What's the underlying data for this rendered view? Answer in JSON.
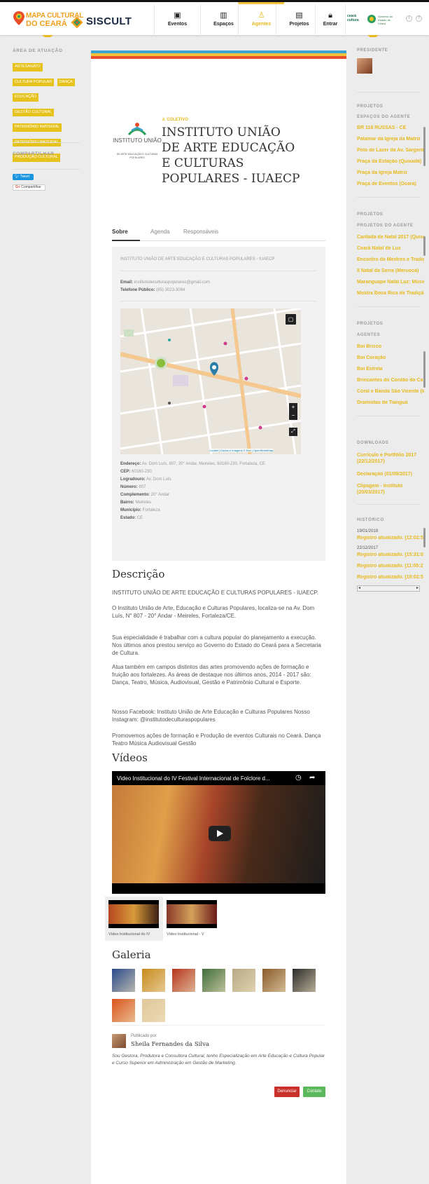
{
  "header": {
    "logo_line1": "MAPA CULTURAL",
    "logo_line2": "DO CEARÁ",
    "siscult": "SISCULT",
    "nav": [
      {
        "label": "Eventos",
        "icon": "calendar-icon"
      },
      {
        "label": "Espaços",
        "icon": "building-icon"
      },
      {
        "label": "Agentes",
        "icon": "person-icon",
        "active": true
      },
      {
        "label": "Projetos",
        "icon": "document-icon"
      },
      {
        "label": "Entrar",
        "icon": "lock-icon"
      }
    ],
    "right_logo": "ceará cultura",
    "gov_text": "Governo do Estado do Ceará"
  },
  "left": {
    "area_title": "ÁREA DE ATUAÇÃO",
    "tags": [
      "ARTESANATO",
      "CULTURA POPULAR",
      "DANÇA",
      "EDUCAÇÃO",
      "GESTÃO CULTURAL",
      "PATRIMÔNIO IMATERIAL",
      "PATRIMÔNIO MATERIAL",
      "PRODUÇÃO CULTURAL"
    ],
    "share_title": "COMPARTILHAR",
    "tweet": "Tweet",
    "gplus": "Compartilhar"
  },
  "profile": {
    "type": "COLETIVO",
    "name": "INSTITUTO UNIÃO DE ARTE EDUCAÇÃO E CULTURAS POPULARES - IUAECP",
    "logo_text": "INSTITUTO UNIÃO",
    "logo_sub": "DE ARTE EDUCAÇÃO E CULTURAS POPULARES",
    "tabs": [
      "Sobre",
      "Agenda",
      "Responsáveis"
    ],
    "short_desc": "INSTITUTO UNIÃO DE ARTE EDUCAÇÃO E CULTURAS POPULARES - IUAECP",
    "email_label": "Email:",
    "email": "institutodeculturaspopulares@gmail.com",
    "phone_label": "Telefone Público:",
    "phone": "(85) 3023-3064",
    "map_attr": "Leaflet | Dados e Imagens © Esri | OpenStreetMap",
    "address": [
      {
        "label": "Endereço:",
        "value": "Av. Dom Luís, 807, 20° Andar, Meireles, 60160-230, Fortaleza, CE"
      },
      {
        "label": "CEP:",
        "value": "60160-230"
      },
      {
        "label": "Logradouro:",
        "value": "Av. Dom Luís"
      },
      {
        "label": "Número:",
        "value": "807"
      },
      {
        "label": "Complemento:",
        "value": "20° Andar"
      },
      {
        "label": "Bairro:",
        "value": "Meireles"
      },
      {
        "label": "Município:",
        "value": "Fortaleza"
      },
      {
        "label": "Estado:",
        "value": "CE"
      }
    ]
  },
  "description": {
    "title": "Descrição",
    "paragraphs": [
      "INSTITUTO UNIÃO DE ARTE EDUCAÇÃO E CULTURAS POPULARES - IUAECP.",
      "O Instituto União de Arte, Educação e Culturas Populares, localiza-se na Av. Dom Luís, N° 807 - 20° Andar - Meireles, Fortaleza/CE.",
      "Sua especialidade é trabalhar com a cultura popular do planejamento a execução. Nos últimos anos prestou serviço ao Governo do Estado do Ceará para a Secretaria de Cultura.",
      "Atua também em campos distintos das artes promovendo ações de formação e fruição aos fortalezes. As áreas de destaque nos últimos anos, 2014 - 2017 são: Dança, Teatro, Música, Audiovisual, Gestão e Patrimônio Cultural e Esporte.",
      "Nosso Facebook: Instituto União de Arte Educação e Culturas Populares Nosso Instagram: @institutodeculturaspopulares",
      "Promovemos ações de formação e Produção de eventos Culturais no Ceará. Dança  Teatro  Música  Audiovisual  Gestão"
    ]
  },
  "videos": {
    "title": "Vídeos",
    "player_title": "Video Institucional do IV Festival Internacional de Folclore d...",
    "thumbs": [
      "Vídeo Institucional do IV",
      "Vídeo Institucional - V"
    ]
  },
  "gallery": {
    "title": "Galeria",
    "colors": [
      "#2a4a8a",
      "#c88a1c",
      "#b5361f",
      "#3f6d3a",
      "#b8a985",
      "#8a5a2a",
      "#2a2a2a",
      "#d9541a",
      "#e0c79a"
    ]
  },
  "author": {
    "published_by": "Publicado por",
    "name": "Sheila Fernandes da Silva",
    "bio": "Sou Gestora, Produtora e Consultora Cultural, tenho Especialização em Arte Educação e Cultura Popular e Curso Superior em Administração em Gestão de Marketing."
  },
  "actions": {
    "report": "Denunciar",
    "contact": "Contato"
  },
  "right": {
    "president_title": "PRESIDENTE",
    "projects_title": "PROJETOS",
    "spaces_title": "ESPAÇOS DO AGENTE",
    "spaces": [
      "BR 116 RUSSAS - CE",
      "Patamar da Igreja da Matriz",
      "Polo de Lazer da Av. Sargento",
      "Praça da Estação (Quixadá)",
      "Praça da Igreja Matriz",
      "Praça de Eventos (Ocara)"
    ],
    "projects2_title": "PROJETOS",
    "agent_projects_title": "PROJETOS DO AGENTE",
    "agent_projects": [
      "Cantada de Natal 2017 (Quixadá)",
      "Ceará Natal de Luz",
      "Encontro de Mestres e Tradições",
      "II Natal da Serra (Meruoca)",
      "Maranguape Natal Luz: Música",
      "Mostra Boca Rica de Tradição"
    ],
    "projects3_title": "PROJETOS",
    "agents_title": "AGENTES",
    "agents": [
      "Boi Bricco",
      "Boi Coração",
      "Boi Estrela",
      "Brincantes do Cordão do Caroá",
      "Coral e Banda São Vicente (Icó)",
      "Dramistas de Tianguá"
    ],
    "downloads_title": "DOWNLOADS",
    "downloads": [
      "Currículo e Portfólio 2017 (22/12/2017)",
      "Declaração (01/09/2017)",
      "Clipagem - Instituto (20/03/2017)"
    ],
    "history_title": "HISTÓRICO",
    "history": [
      {
        "date": "19/01/2018",
        "entry": "Registro atualizado. [12:02:5"
      },
      {
        "date": "22/12/2017",
        "entry": "Registro atualizado. [15:31:0"
      },
      {
        "date": "",
        "entry": "Registro atualizado. [11:05:2"
      },
      {
        "date": "",
        "entry": "Registro atualizado. [10:02:5"
      }
    ]
  }
}
